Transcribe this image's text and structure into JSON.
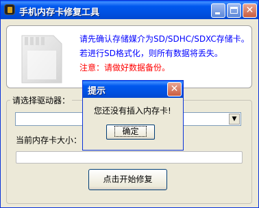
{
  "window": {
    "title": "手机内存卡修复工具",
    "icon": "sd-chip-icon",
    "controls": {
      "minimize": "minimize-icon",
      "maximize": "maximize-icon",
      "close": "✕"
    }
  },
  "info": {
    "line1": "请先确认存储媒介为SD/SDHC/SDXC存储卡。",
    "line2": "若进行SD格式化，则所有数据将丢失。",
    "line3": "注意：请做好数据备份。",
    "colors": {
      "text": "#0000ff",
      "warning": "#ff0000"
    }
  },
  "drive": {
    "group_label": "请选择驱动器：",
    "selected": "",
    "size_label": "当前内存卡大小：",
    "size_value": "",
    "progress": 0
  },
  "actions": {
    "start_label": "点击开始修复"
  },
  "dialog": {
    "title": "提示",
    "message": "您还没有插入内存卡!",
    "ok_label": "确定",
    "close": "✕"
  }
}
